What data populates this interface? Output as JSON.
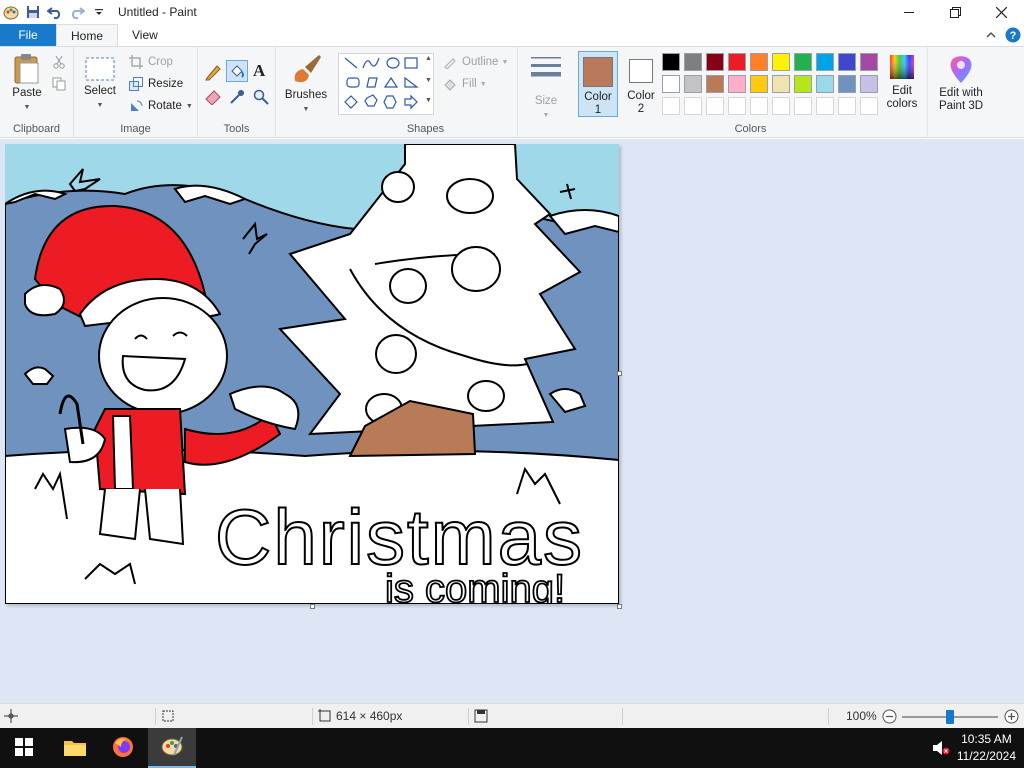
{
  "window": {
    "title": "Untitled - Paint"
  },
  "tabs": {
    "file": "File",
    "home": "Home",
    "view": "View"
  },
  "ribbon": {
    "clipboard": {
      "paste": "Paste",
      "group": "Clipboard"
    },
    "image": {
      "select": "Select",
      "crop": "Crop",
      "resize": "Resize",
      "rotate": "Rotate",
      "group": "Image"
    },
    "tools": {
      "group": "Tools",
      "text_tool": "A"
    },
    "brushes": {
      "label": "Brushes"
    },
    "shapes": {
      "outline": "Outline",
      "fill": "Fill",
      "group": "Shapes"
    },
    "size": {
      "label": "Size"
    },
    "colors": {
      "color1_label": "Color",
      "color1_num": "1",
      "color2_label": "Color",
      "color2_num": "2",
      "color1_value": "#b9795a",
      "color2_value": "#ffffff",
      "edit_colors_line1": "Edit",
      "edit_colors_line2": "colors",
      "group": "Colors",
      "palette_row1": [
        "#000000",
        "#7f7f7f",
        "#880015",
        "#ed1c24",
        "#ff7f27",
        "#fff200",
        "#22b14c",
        "#00a2e8",
        "#3f48cc",
        "#a349a4"
      ],
      "palette_row2": [
        "#ffffff",
        "#c3c3c3",
        "#b97a57",
        "#ffaec9",
        "#ffc90e",
        "#efe4b0",
        "#b5e61d",
        "#99d9ea",
        "#7092be",
        "#c8bfe7"
      ]
    },
    "paint3d": {
      "line1": "Edit with",
      "line2": "Paint 3D"
    }
  },
  "canvas": {
    "caption_word": "Christmas",
    "caption_line2": "is coming!"
  },
  "status": {
    "image_size": "614 × 460px",
    "zoom": "100%",
    "zoom_fraction": 0.5
  },
  "taskbar": {
    "time": "10:35 AM",
    "date": "11/22/2024"
  }
}
